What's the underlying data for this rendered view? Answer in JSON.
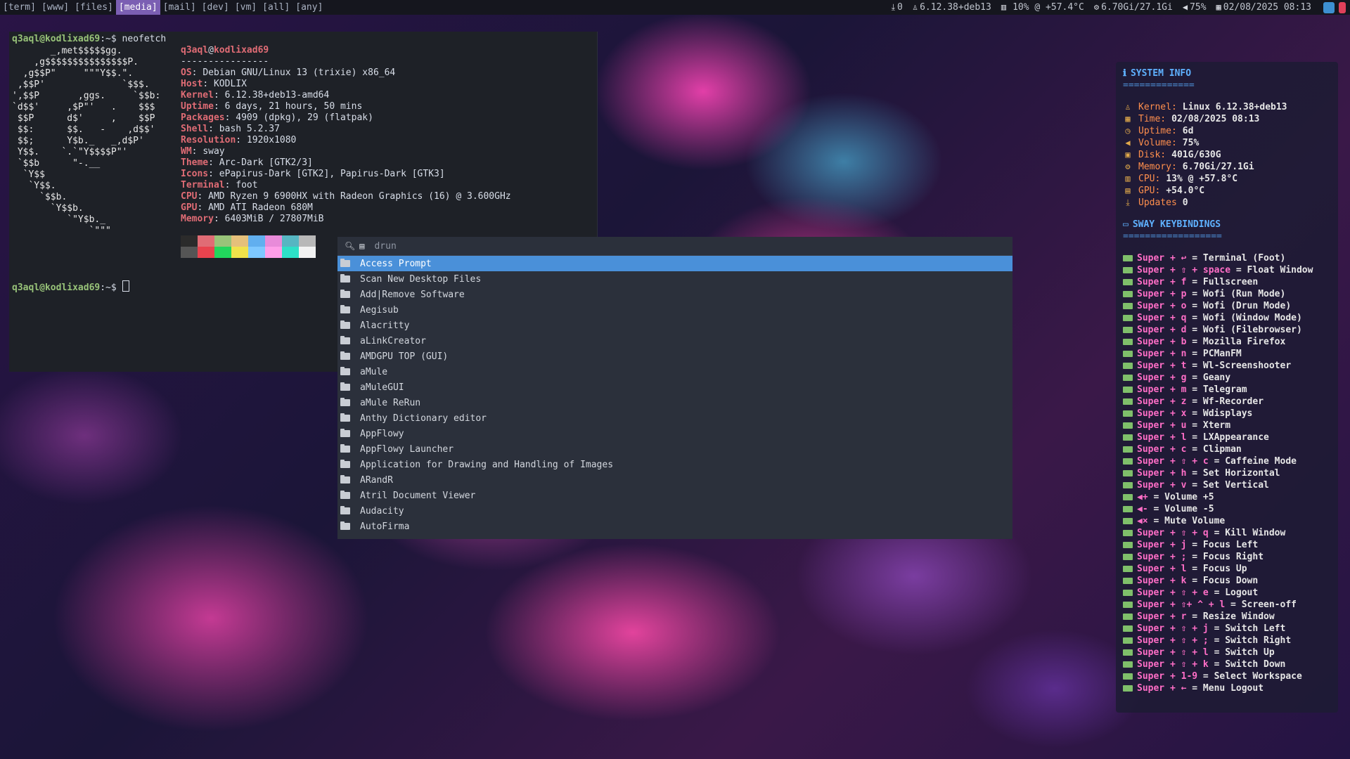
{
  "topbar": {
    "workspaces": [
      "[term]",
      "[www]",
      "[files]",
      "[media]",
      "[mail]",
      "[dev]",
      "[vm]",
      "[all]",
      "[any]"
    ],
    "active_workspace": "[media]",
    "updates": "0",
    "kernel": "6.12.38+deb13",
    "cpu": "10% @ +57.4°C",
    "memory": "6.70Gi/27.1Gi",
    "volume": "75%",
    "datetime": "02/08/2025 08:13"
  },
  "terminal": {
    "prompt1": "q3aql@kodlixad69:~$ neofetch",
    "prompt2": "q3aql@kodlixad69:~$ ",
    "prompt_user": "q3aql@kodlixad69",
    "prompt_path": ":~$ ",
    "command": "neofetch",
    "ascii": [
      "       _,met$$$$$gg.",
      "    ,g$$$$$$$$$$$$$$$P.",
      "  ,g$$P\"     \"\"\"Y$$.\".",
      " ,$$P'              `$$$.",
      "',$$P       ,ggs.     `$$b:",
      "`d$$'     ,$P\"'   .    $$$",
      " $$P      d$'     ,    $$P",
      " $$:      $$.   -    ,d$$'",
      " $$;      Y$b._   _,d$P'",
      " Y$$.    `.`\"Y$$$$P\"'",
      " `$$b      \"-.__",
      "  `Y$$",
      "   `Y$$.",
      "     `$$b.",
      "       `Y$$b.",
      "          `\"Y$b._",
      "              `\"\"\""
    ],
    "header_user": "q3aql",
    "header_at": "@",
    "header_host": "kodlixad69",
    "separator": "----------------",
    "info": [
      {
        "k": "OS",
        "v": "Debian GNU/Linux 13 (trixie) x86_64"
      },
      {
        "k": "Host",
        "v": "KODLIX"
      },
      {
        "k": "Kernel",
        "v": "6.12.38+deb13-amd64"
      },
      {
        "k": "Uptime",
        "v": "6 days, 21 hours, 50 mins"
      },
      {
        "k": "Packages",
        "v": "4909 (dpkg), 29 (flatpak)"
      },
      {
        "k": "Shell",
        "v": "bash 5.2.37"
      },
      {
        "k": "Resolution",
        "v": "1920x1080"
      },
      {
        "k": "WM",
        "v": "sway"
      },
      {
        "k": "Theme",
        "v": "Arc-Dark [GTK2/3]"
      },
      {
        "k": "Icons",
        "v": "ePapirus-Dark [GTK2], Papirus-Dark [GTK3]"
      },
      {
        "k": "Terminal",
        "v": "foot"
      },
      {
        "k": "CPU",
        "v": "AMD Ryzen 9 6900HX with Radeon Graphics (16) @ 3.600GHz"
      },
      {
        "k": "GPU",
        "v": "AMD ATI Radeon 680M"
      },
      {
        "k": "Memory",
        "v": "6403MiB / 27807MiB"
      }
    ],
    "swatch_colors_top": [
      "#2b2b2b",
      "#e06c75",
      "#98c379",
      "#e5c07b",
      "#61afef",
      "#e88bd9",
      "#56b6c2",
      "#b8b8b8"
    ],
    "swatch_colors_bottom": [
      "#555555",
      "#e8434e",
      "#22d65c",
      "#f0e24b",
      "#7ec8ff",
      "#ff9ee8",
      "#2de0c7",
      "#f2f2f2"
    ]
  },
  "wofi": {
    "query": "drun",
    "items": [
      "Access Prompt",
      "Scan New Desktop Files",
      "Add|Remove Software",
      "Aegisub",
      "Alacritty",
      "aLinkCreator",
      "AMDGPU TOP (GUI)",
      "aMule",
      "aMuleGUI",
      "aMule ReRun",
      "Anthy Dictionary editor",
      "AppFlowy",
      "AppFlowy Launcher",
      "Application for Drawing and Handling of Images",
      "ARandR",
      "Atril Document Viewer",
      "Audacity",
      "AutoFirma"
    ],
    "selected_index": 0
  },
  "panel": {
    "sysinfo_title": "SYSTEM INFO",
    "sysinfo_underline": "=============",
    "sysinfo": [
      {
        "icon": "linux-icon",
        "glyph": "♙",
        "label": "Kernel:",
        "value": "Linux 6.12.38+deb13"
      },
      {
        "icon": "calendar-icon",
        "glyph": "▦",
        "label": "Time:",
        "value": "02/08/2025 08:13"
      },
      {
        "icon": "clock-icon",
        "glyph": "◷",
        "label": "Uptime:",
        "value": "6d"
      },
      {
        "icon": "speaker-icon",
        "glyph": "◀",
        "label": "Volume:",
        "value": "75%"
      },
      {
        "icon": "disk-icon",
        "glyph": "▣",
        "label": "Disk:",
        "value": "401G/630G"
      },
      {
        "icon": "memory-icon",
        "glyph": "⚙",
        "label": "Memory:",
        "value": "6.70Gi/27.1Gi"
      },
      {
        "icon": "cpu-icon",
        "glyph": "▥",
        "label": "CPU:",
        "value": "13% @ +57.8°C"
      },
      {
        "icon": "gpu-icon",
        "glyph": "▤",
        "label": "GPU:",
        "value": "+54.0°C"
      },
      {
        "icon": "download-icon",
        "glyph": "⤓",
        "label": "Updates",
        "value": "0"
      }
    ],
    "kb_title": "SWAY KEYBINDINGS",
    "kb_underline": "==================",
    "keybindings": [
      {
        "keys": "Super + ↩",
        "action": " = Terminal (Foot)"
      },
      {
        "keys": "Super + ⇧ + space",
        "action": " = Float Window"
      },
      {
        "keys": "Super + f",
        "action": " = Fullscreen"
      },
      {
        "keys": "Super + p",
        "action": " = Wofi (Run Mode)"
      },
      {
        "keys": "Super + o",
        "action": " = Wofi (Drun Mode)"
      },
      {
        "keys": "Super + q",
        "action": " = Wofi (Window Mode)"
      },
      {
        "keys": "Super + d",
        "action": " = Wofi (Filebrowser)"
      },
      {
        "keys": "Super + b",
        "action": " = Mozilla Firefox"
      },
      {
        "keys": "Super + n",
        "action": " = PCManFM"
      },
      {
        "keys": "Super + t",
        "action": " = Wl-Screenshooter"
      },
      {
        "keys": "Super + g",
        "action": " = Geany"
      },
      {
        "keys": "Super + m",
        "action": " = Telegram"
      },
      {
        "keys": "Super + z",
        "action": " = Wf-Recorder"
      },
      {
        "keys": "Super + x",
        "action": " = Wdisplays"
      },
      {
        "keys": "Super + u",
        "action": " = Xterm"
      },
      {
        "keys": "Super + l",
        "action": " = LXAppearance"
      },
      {
        "keys": "Super + c",
        "action": " = Clipman"
      },
      {
        "keys": "Super + ⇧ + c",
        "action": " = Caffeine Mode"
      },
      {
        "keys": "Super + h",
        "action": " = Set Horizontal"
      },
      {
        "keys": "Super + v",
        "action": " = Set Vertical"
      },
      {
        "keys": "◀+",
        "action": " = Volume +5"
      },
      {
        "keys": "◀-",
        "action": " = Volume -5"
      },
      {
        "keys": "◀×",
        "action": " = Mute Volume"
      },
      {
        "keys": "Super + ⇧ + q",
        "action": " = Kill Window"
      },
      {
        "keys": "Super + j",
        "action": " = Focus Left"
      },
      {
        "keys": "Super + ;",
        "action": " = Focus Right"
      },
      {
        "keys": "Super + l",
        "action": " = Focus Up"
      },
      {
        "keys": "Super + k",
        "action": " = Focus Down"
      },
      {
        "keys": "Super + ⇧ + e",
        "action": " = Logout"
      },
      {
        "keys": "Super + ⇧+ ^ + l",
        "action": " = Screen-off"
      },
      {
        "keys": "Super + r",
        "action": " = Resize Window"
      },
      {
        "keys": "Super + ⇧ + j",
        "action": " = Switch Left"
      },
      {
        "keys": "Super + ⇧ + ;",
        "action": " = Switch Right"
      },
      {
        "keys": "Super + ⇧ + l",
        "action": " = Switch Up"
      },
      {
        "keys": "Super + ⇧ + k",
        "action": " = Switch Down"
      },
      {
        "keys": "Super + 1-9",
        "action": " = Select Workspace"
      },
      {
        "keys": "Super + ←",
        "action": " = Menu Logout"
      }
    ]
  }
}
